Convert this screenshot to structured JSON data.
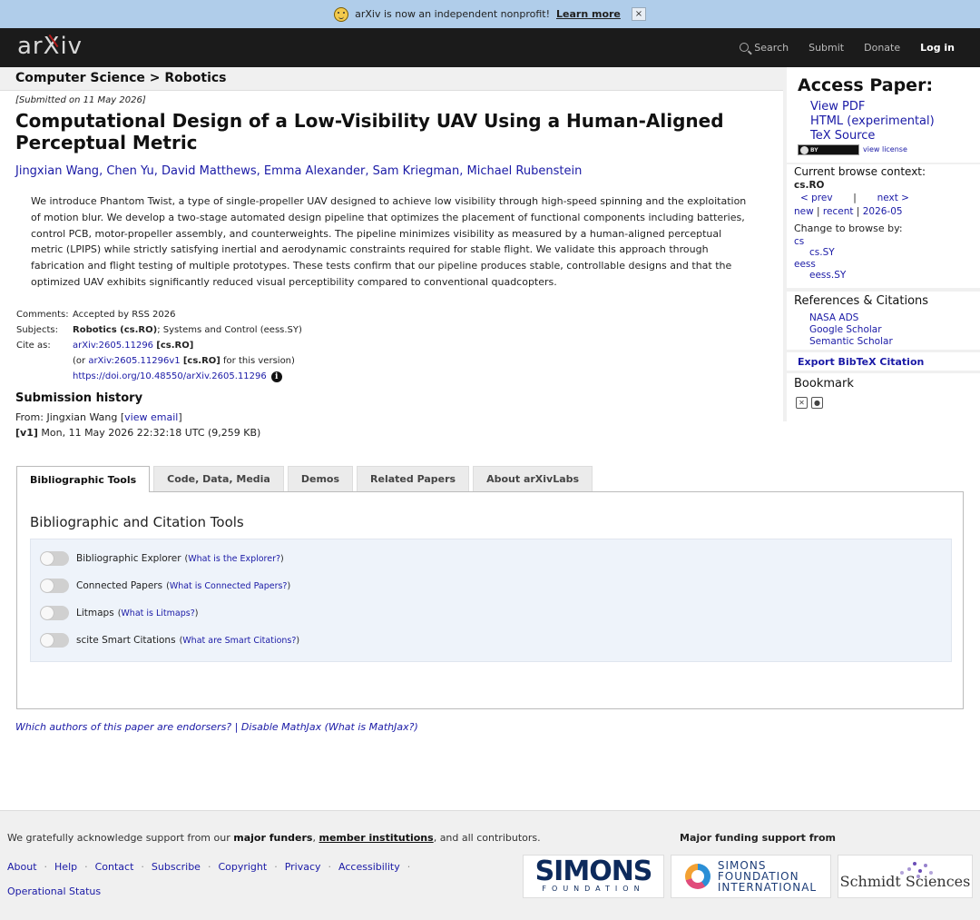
{
  "banner": {
    "text": "arXiv is now an independent nonprofit!",
    "link": "Learn more",
    "close": "×"
  },
  "header": {
    "logo": {
      "a": "ar",
      "x": "X",
      "b": "iv"
    },
    "search": "Search",
    "submit": "Submit",
    "donate": "Donate",
    "login": "Log in"
  },
  "breadcrumb": "Computer Science > Robotics",
  "paper": {
    "submitted": "[Submitted on 11 May 2026]",
    "title": "Computational Design of a Low-Visibility UAV Using a Human-Aligned Perceptual Metric",
    "authors": [
      "Jingxian Wang",
      "Chen Yu",
      "David Matthews",
      "Emma Alexander",
      "Sam Kriegman",
      "Michael Rubenstein"
    ],
    "abstract": "We introduce Phantom Twist, a type of single-propeller UAV designed to achieve low visibility through high-speed spinning and the exploitation of motion blur. We develop a two-stage automated design pipeline that optimizes the placement of functional components including batteries, control PCB, motor-propeller assembly, and counterweights. The pipeline minimizes visibility as measured by a human-aligned perceptual metric (LPIPS) while strictly satisfying inertial and aerodynamic constraints required for stable flight. We validate this approach through fabrication and flight testing of multiple prototypes. These tests confirm that our pipeline produces stable, controllable designs and that the optimized UAV exhibits significantly reduced visual perceptibility compared to conventional quadcopters."
  },
  "meta": {
    "comments_label": "Comments:",
    "comments": "Accepted by RSS 2026",
    "subjects_label": "Subjects:",
    "subjects_main": "Robotics (cs.RO)",
    "subjects_rest": "; Systems and Control (eess.SY)",
    "cite_label": "Cite as:",
    "cite_id": "arXiv:2605.11296",
    "cite_cat": "[cs.RO]",
    "cite_or": "(or ",
    "cite_v1": "arXiv:2605.11296v1",
    "cite_v1_cat": "[cs.RO]",
    "cite_v1_suffix": " for this version)",
    "doi": "https://doi.org/10.48550/arXiv.2605.11296",
    "info": "i"
  },
  "history": {
    "title": "Submission history",
    "from_prefix": "From: Jingxian Wang [",
    "view_email": "view email",
    "from_suffix": "]",
    "v1_label": "[v1]",
    "v1_text": " Mon, 11 May 2026 22:32:18 UTC (9,259 KB)"
  },
  "tabs": [
    "Bibliographic Tools",
    "Code, Data, Media",
    "Demos",
    "Related Papers",
    "About arXivLabs"
  ],
  "panel": {
    "title": "Bibliographic and Citation Tools",
    "tools": [
      {
        "label": "Bibliographic Explorer",
        "help": "What is the Explorer?"
      },
      {
        "label": "Connected Papers",
        "help": "What is Connected Papers?"
      },
      {
        "label": "Litmaps",
        "help": "What is Litmaps?"
      },
      {
        "label": "scite Smart Citations",
        "help": "What are Smart Citations?"
      }
    ]
  },
  "endorse": {
    "a": "Which authors of this paper are endorsers?",
    "sep": " | ",
    "b": "Disable MathJax",
    "c": " (What is MathJax?)"
  },
  "sidebar": {
    "access_title": "Access Paper:",
    "links": [
      "View PDF",
      "HTML (experimental)",
      "TeX Source"
    ],
    "cc": "BY",
    "view_license": "view license",
    "context_title": "Current browse context:",
    "context": "cs.RO",
    "prev": "< prev",
    "pipe": "|",
    "next": "next >",
    "new": "new",
    "recent": "recent",
    "month": "2026-05",
    "change_by": "Change to browse by:",
    "browse": [
      {
        "main": "cs",
        "sub": "cs.SY"
      },
      {
        "main": "eess",
        "sub": "eess.SY"
      }
    ],
    "refs_title": "References & Citations",
    "refs": [
      "NASA ADS",
      "Google Scholar",
      "Semantic Scholar"
    ],
    "export": "Export BibTeX Citation",
    "bookmark": "Bookmark"
  },
  "footer": {
    "ack_a": "We gratefully acknowledge support from our ",
    "ack_b": "major funders",
    "ack_c": ", ",
    "ack_d": "member institutions",
    "ack_e": ", and all contributors.",
    "links": [
      "About",
      "Help",
      "Contact",
      "Subscribe",
      "Copyright",
      "Privacy",
      "Accessibility"
    ],
    "status": "Operational Status",
    "funding_label": "Major funding support from",
    "simons": "SIMONS",
    "simons_sub": "FOUNDATION",
    "sfi": [
      "SIMONS",
      "FOUNDATION",
      "INTERNATIONAL"
    ],
    "schmidt": "Schmidt Sciences"
  }
}
